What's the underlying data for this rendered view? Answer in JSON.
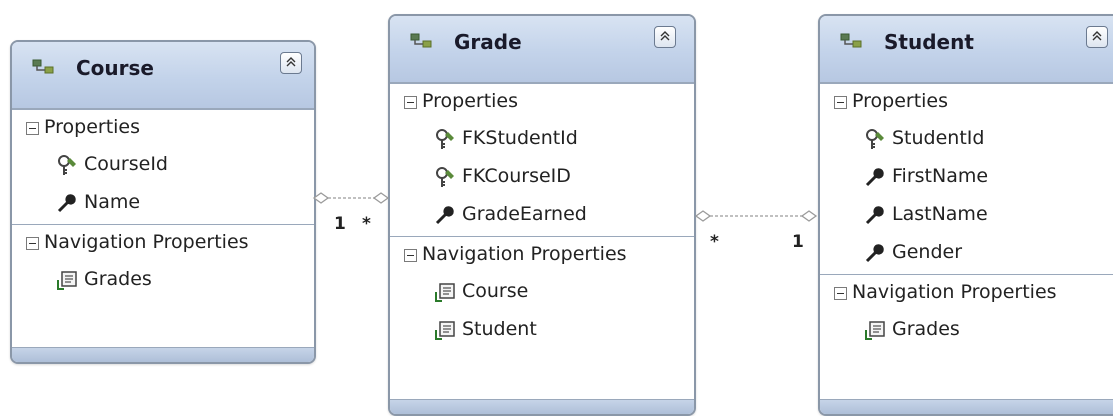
{
  "entities": {
    "course": {
      "title": "Course",
      "properties_label": "Properties",
      "properties": [
        {
          "name": "CourseId",
          "icon": "key-icon"
        },
        {
          "name": "Name",
          "icon": "wrench-icon"
        }
      ],
      "navigation_label": "Navigation Properties",
      "navigation": [
        {
          "name": "Grades",
          "icon": "navigation-icon"
        }
      ]
    },
    "grade": {
      "title": "Grade",
      "properties_label": "Properties",
      "properties": [
        {
          "name": "FKStudentId",
          "icon": "key-icon"
        },
        {
          "name": "FKCourseID",
          "icon": "key-icon"
        },
        {
          "name": "GradeEarned",
          "icon": "wrench-icon"
        }
      ],
      "navigation_label": "Navigation Properties",
      "navigation": [
        {
          "name": "Course",
          "icon": "navigation-icon"
        },
        {
          "name": "Student",
          "icon": "navigation-icon"
        }
      ]
    },
    "student": {
      "title": "Student",
      "properties_label": "Properties",
      "properties": [
        {
          "name": "StudentId",
          "icon": "key-icon"
        },
        {
          "name": "FirstName",
          "icon": "wrench-icon"
        },
        {
          "name": "LastName",
          "icon": "wrench-icon"
        },
        {
          "name": "Gender",
          "icon": "wrench-icon"
        }
      ],
      "navigation_label": "Navigation Properties",
      "navigation": [
        {
          "name": "Grades",
          "icon": "navigation-icon"
        }
      ]
    }
  },
  "associations": {
    "course_grade": {
      "left": "1",
      "right": "*"
    },
    "grade_student": {
      "left": "*",
      "right": "1"
    }
  },
  "colors": {
    "header": "#c3d3ea",
    "border": "#8a97a8",
    "connector": "#9a9a9a"
  }
}
